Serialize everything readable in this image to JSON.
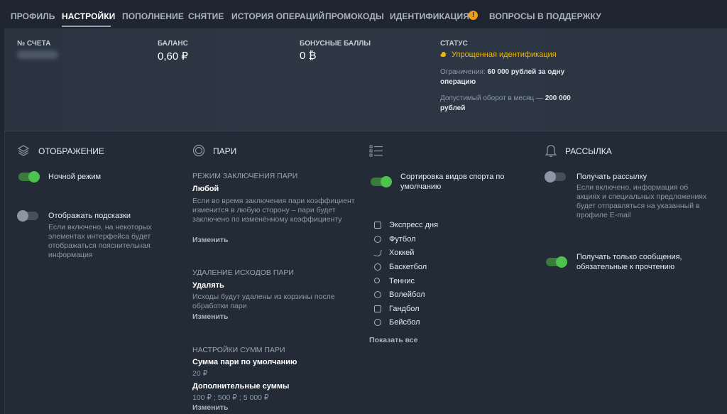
{
  "nav": {
    "tabs": [
      {
        "label": "Профиль"
      },
      {
        "label": "Настройки"
      },
      {
        "label": "Пополнение"
      },
      {
        "label": "Снятие"
      },
      {
        "label": "История операций"
      },
      {
        "label": "Промокоды"
      },
      {
        "label": "Идентификация"
      },
      {
        "label": "Вопросы в поддержку"
      }
    ],
    "warning_badge": "!"
  },
  "account": {
    "number_label": "№ счета",
    "balance_label": "Баланс",
    "balance_value": "0,60 ₽",
    "bonus_label": "Бонусные баллы",
    "bonus_value": "0 ₿",
    "status_label": "Статус",
    "status_value": "Упрощенная идентификация",
    "limit_prefix": "Ограничения: ",
    "limit_value": "60 000 рублей за одну операцию",
    "turnover_prefix": "Допустимый оборот в месяц — ",
    "turnover_value": "200 000 рублей"
  },
  "display": {
    "title": "Отображение",
    "night_mode_label": "Ночной режим",
    "night_mode_on": true,
    "hints_label": "Отображать подсказки",
    "hints_on": false,
    "hints_desc": "Если включено, на некоторых элементах интерфейса будет отображаться пояснительная информация"
  },
  "bets": {
    "title": "Пари",
    "mode_caption": "Режим заключения пари",
    "mode_value": "Любой",
    "mode_desc": "Если во время заключения пари коэффициент изменится в любую сторону – пари будет заключено по изменённому коэффициенту",
    "mode_change": "Изменить",
    "remove_caption": "Удаление исходов пари",
    "remove_value": "Удалять",
    "remove_desc": "Исходы будут удалены из корзины после обработки пари",
    "remove_change": "Изменить",
    "sums_caption": "Настройки сумм пари",
    "default_sum_label": "Сумма пари по умолчанию",
    "default_sum_value": "20 ₽",
    "extra_sums_label": "Дополнительные суммы",
    "extra_sums_value": "100 ₽ ; 500 ₽ ; 5 000 ₽",
    "sums_change": "Изменить"
  },
  "sports": {
    "sort_label": "Сортировка видов спорта по умолчанию",
    "sort_on": true,
    "items": [
      {
        "label": "Экспресс дня",
        "icon": "calendar-icon"
      },
      {
        "label": "Футбол",
        "icon": "football-icon"
      },
      {
        "label": "Хоккей",
        "icon": "hockey-icon"
      },
      {
        "label": "Баскетбол",
        "icon": "basketball-icon"
      },
      {
        "label": "Теннис",
        "icon": "tennis-icon"
      },
      {
        "label": "Волейбол",
        "icon": "volleyball-icon"
      },
      {
        "label": "Гандбол",
        "icon": "handball-icon"
      },
      {
        "label": "Бейсбол",
        "icon": "baseball-icon"
      }
    ],
    "show_all": "Показать все"
  },
  "mailing": {
    "title": "Рассылка",
    "receive_label": "Получать рассылку",
    "receive_on": false,
    "receive_desc": "Если включено, информация об акциях и специальных предложениях будет отправляться на указанный в профиле E-mail",
    "mandatory_label": "Получать только сообщения, обязательные к прочтению",
    "mandatory_on": true
  }
}
